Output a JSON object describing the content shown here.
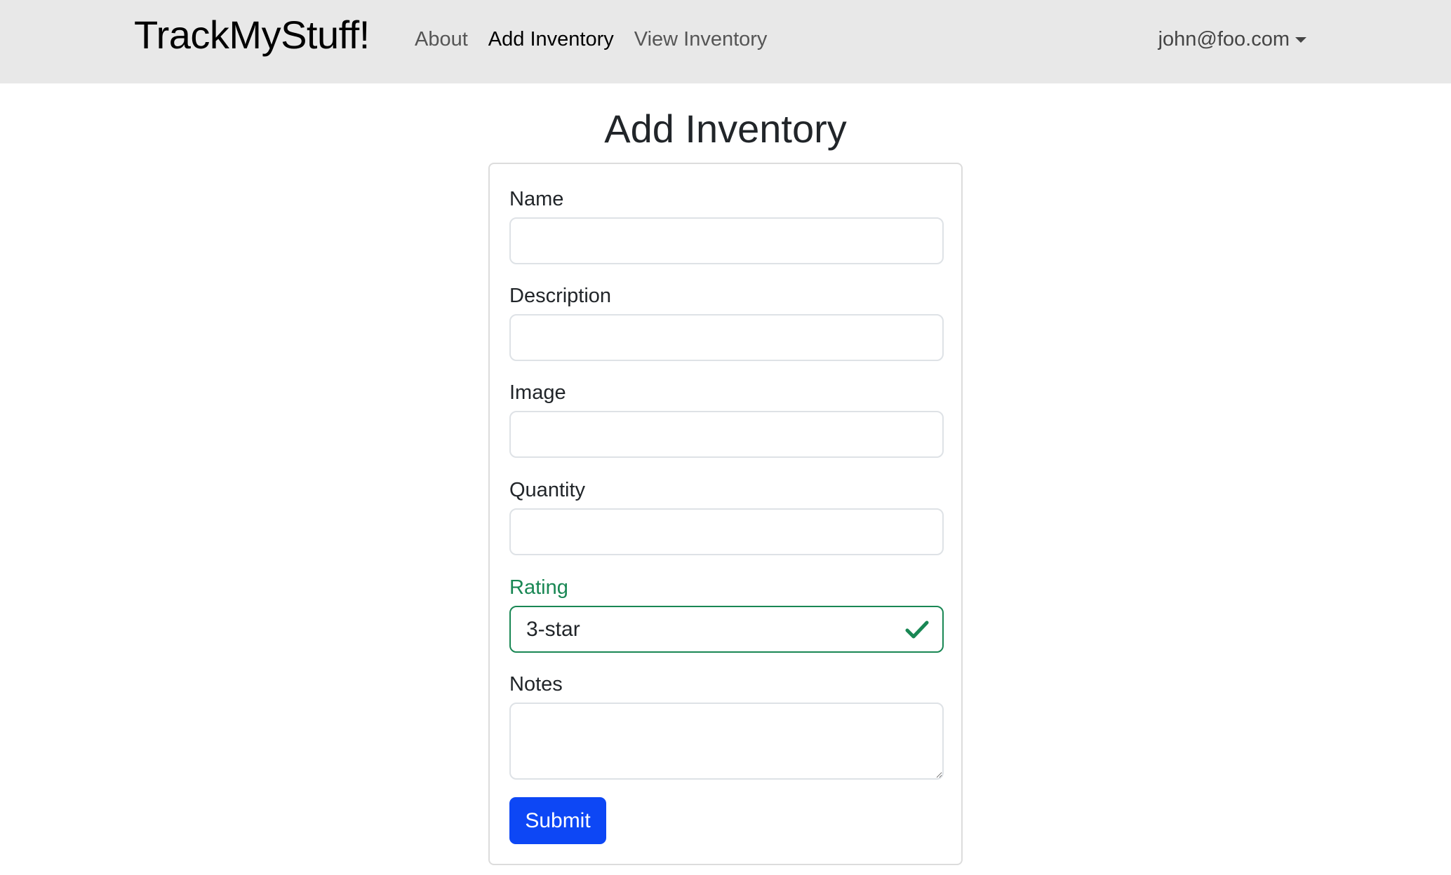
{
  "navbar": {
    "brand": "TrackMyStuff!",
    "links": [
      {
        "label": "About",
        "active": false
      },
      {
        "label": "Add Inventory",
        "active": true
      },
      {
        "label": "View Inventory",
        "active": false
      }
    ],
    "user": "john@foo.com",
    "user_icon": "caret-down-icon",
    "background": "#e8e8e8"
  },
  "page": {
    "title": "Add Inventory"
  },
  "form": {
    "name": {
      "label": "Name",
      "value": ""
    },
    "description": {
      "label": "Description",
      "value": ""
    },
    "image": {
      "label": "Image",
      "value": ""
    },
    "quantity": {
      "label": "Quantity",
      "value": ""
    },
    "rating": {
      "label": "Rating",
      "value": "3-star",
      "state": "valid",
      "icon": "checkmark-icon"
    },
    "notes": {
      "label": "Notes",
      "value": ""
    },
    "submit_label": "Submit"
  },
  "colors": {
    "valid": "#198754",
    "primary_button": "#0d47f5"
  }
}
